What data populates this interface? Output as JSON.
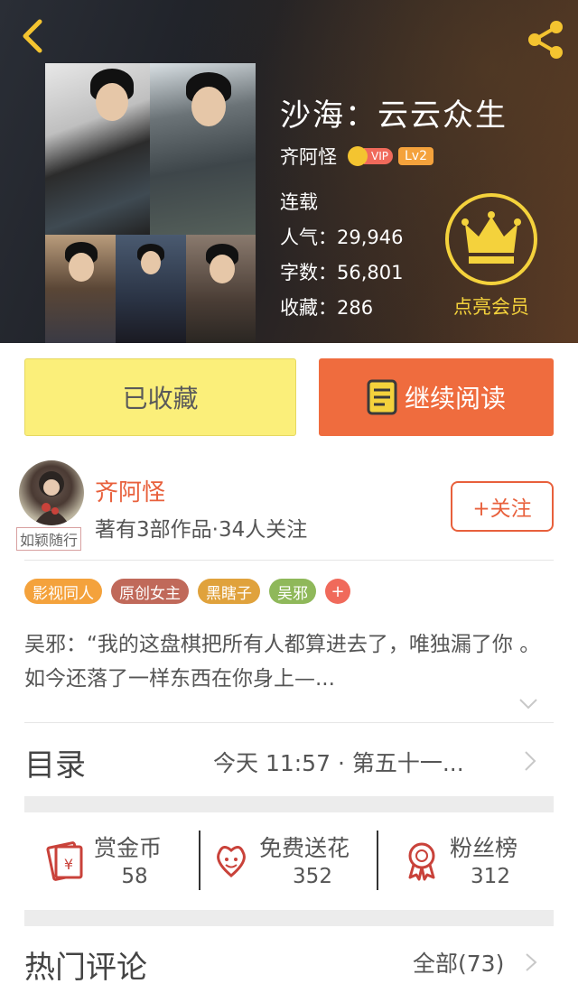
{
  "header": {
    "title": "沙海：云云众生",
    "author": "齐阿怪",
    "vip_label": "VIP",
    "level": "Lv2",
    "status": "连载",
    "popularity": "人气：29,946",
    "word_count": "字数：56,801",
    "favorites": "收藏：286",
    "member_label": "点亮会员",
    "accent": "#f4d23c"
  },
  "actions": {
    "favorited_label": "已收藏",
    "continue_label": "继续阅读"
  },
  "author_card": {
    "avatar_stamp": "如颖随行",
    "name": "齐阿怪",
    "subtitle": "著有3部作品·34人关注",
    "follow_label": "+关注"
  },
  "tags": [
    {
      "label": "影视同人",
      "color": "#f4a23c"
    },
    {
      "label": "原创女主",
      "color": "#c0695a"
    },
    {
      "label": "黑瞎子",
      "color": "#e0a23c"
    },
    {
      "label": "吴邪",
      "color": "#8fb85a"
    }
  ],
  "tag_more": "+",
  "description": "吴邪：“我的这盘棋把所有人都算进去了，唯独漏了你 。如今还落了一样东西在你身上—...",
  "toc": {
    "label": "目录",
    "latest": "今天 11:57 · 第五十一..."
  },
  "stats": [
    {
      "label": "赏金币",
      "value": "58",
      "icon": "red-envelope-icon"
    },
    {
      "label": "免费送花",
      "value": "352",
      "icon": "flower-icon"
    },
    {
      "label": "粉丝榜",
      "value": "312",
      "icon": "medal-icon"
    }
  ],
  "comments": {
    "label": "热门评论",
    "all": "全部(73)"
  }
}
